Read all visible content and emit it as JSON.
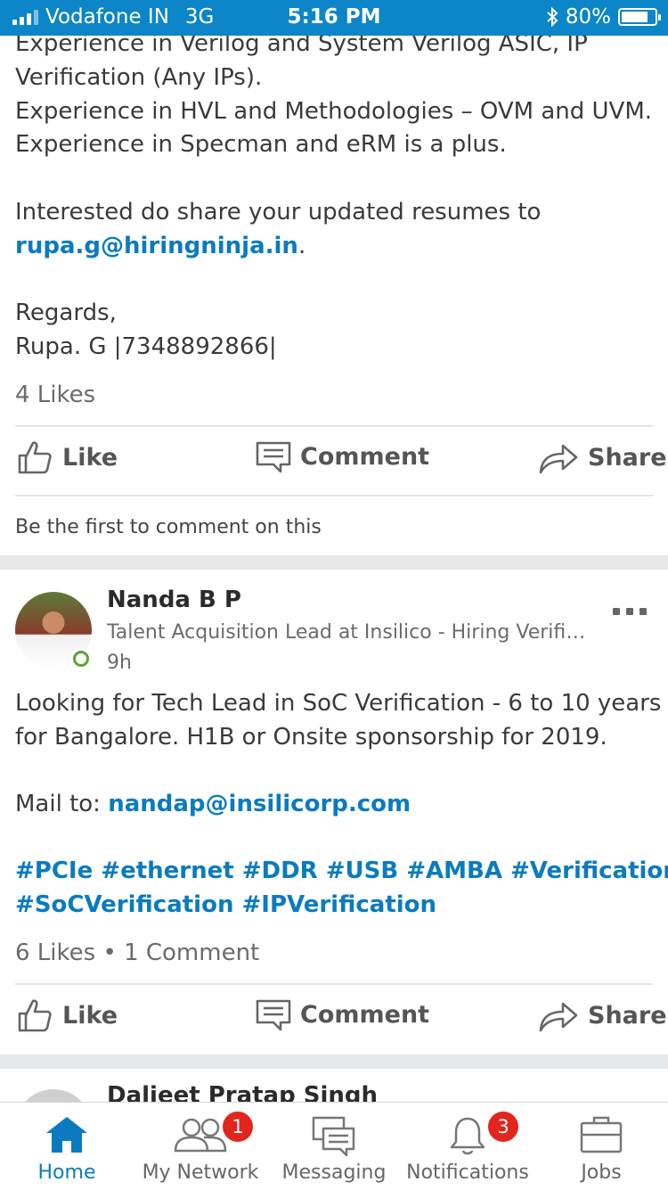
{
  "status_bar": {
    "carrier": "Vodafone IN",
    "network": "3G",
    "time": "5:16 PM",
    "battery": "80%",
    "battery_level": 0.8
  },
  "post1": {
    "lines": [
      "Experience in Verilog and System Verilog ASIC, IP",
      "Verification (Any IPs).",
      "Experience in HVL and Methodologies – OVM and UVM.",
      "Experience in Specman and eRM is a plus.",
      "Interested do share your updated resumes to"
    ],
    "email": "rupa.g@hiringninja.in",
    "email_suffix": ".",
    "regards": "Regards,",
    "signature": "Rupa. G |7348892866|",
    "likes": "4 Likes",
    "first_comment": "Be the first to comment on this"
  },
  "actions": {
    "like": "Like",
    "comment": "Comment",
    "share": "Share"
  },
  "post2": {
    "author": "Nanda B P",
    "headline": "Talent Acquisition Lead at Insilico - Hiring Verific…",
    "time": "9h",
    "body_line1": "Looking for Tech Lead in SoC Verification - 6 to 10 years",
    "body_line2": "for Bangalore. H1B or Onsite sponsorship for 2019.",
    "mail_prefix": "Mail to: ",
    "email": "nandap@insilicorp.com",
    "hashtags_line1": "#PCIe #ethernet #DDR #USB #AMBA #Verification",
    "hashtags_line2": "#SoCVerification #IPVerification",
    "likes": "6 Likes",
    "bullet": "•",
    "comments": "1 Comment"
  },
  "post3": {
    "author": "Daljeet Pratap Singh"
  },
  "tabs": [
    {
      "label": "Home",
      "icon": "home-icon",
      "active": true
    },
    {
      "label": "My Network",
      "icon": "people-icon",
      "badge": "1"
    },
    {
      "label": "Messaging",
      "icon": "messages-icon"
    },
    {
      "label": "Notifications",
      "icon": "bell-icon",
      "badge": "3"
    },
    {
      "label": "Jobs",
      "icon": "briefcase-icon"
    }
  ],
  "colors": {
    "brand": "#0c86c8",
    "link": "#0a7bbf",
    "badge": "#e2251d",
    "online": "#5aa532"
  }
}
